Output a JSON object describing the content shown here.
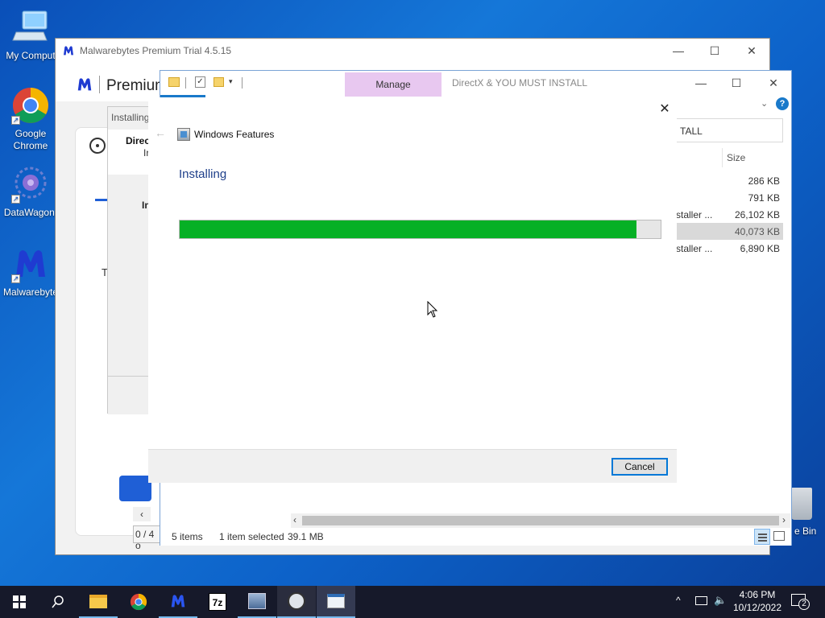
{
  "desktop": {
    "icons": [
      {
        "label": "My Comput",
        "icon": "computer-icon"
      },
      {
        "label": "Google Chrome",
        "icon": "chrome-icon"
      },
      {
        "label": "DataWagon.",
        "icon": "datawagon-icon"
      },
      {
        "label": "Malwarebyte",
        "icon": "malwarebytes-icon"
      },
      {
        "label": "e Bin",
        "icon": "recycle-bin-icon"
      }
    ]
  },
  "malwarebytes": {
    "title": "Malwarebytes Premium Trial  4.5.15",
    "brand": "Premium",
    "scan_panel": {
      "title": "Installing",
      "heading": "Direc",
      "sub": "Ir",
      "bold": "In",
      "progress": "0 / 4 o"
    },
    "left_letter": "T"
  },
  "explorer": {
    "tab_manage": "Manage",
    "title": "DirectX & YOU MUST INSTALL",
    "search_value": "TALL",
    "column_size": "Size",
    "rows": [
      {
        "name": "",
        "size": "286 KB",
        "selected": false
      },
      {
        "name": "",
        "size": "791 KB",
        "selected": false
      },
      {
        "name": "staller ...",
        "size": "26,102 KB",
        "selected": false
      },
      {
        "name": "",
        "size": "40,073 KB",
        "selected": true
      },
      {
        "name": "staller ...",
        "size": "6,890 KB",
        "selected": false
      }
    ],
    "status_items": "5 items",
    "status_selected": "1 item selected",
    "status_size": "39.1 MB",
    "help": "?"
  },
  "windows_features": {
    "title": "Windows Features",
    "heading": "Installing",
    "progress": 0.95,
    "cancel_label": "Cancel"
  },
  "taskbar": {
    "time": "4:06 PM",
    "date": "10/12/2022",
    "notification_count": "2",
    "apps": [
      "file-explorer-icon",
      "chrome-icon",
      "malwarebytes-icon",
      "7zip-icon",
      "installer-icon",
      "unreal-icon",
      "features-icon"
    ]
  },
  "colors": {
    "accent": "#0078d7",
    "progress": "#06b025",
    "manage_tab": "#e8c8f0",
    "taskbar": "#16192a"
  }
}
